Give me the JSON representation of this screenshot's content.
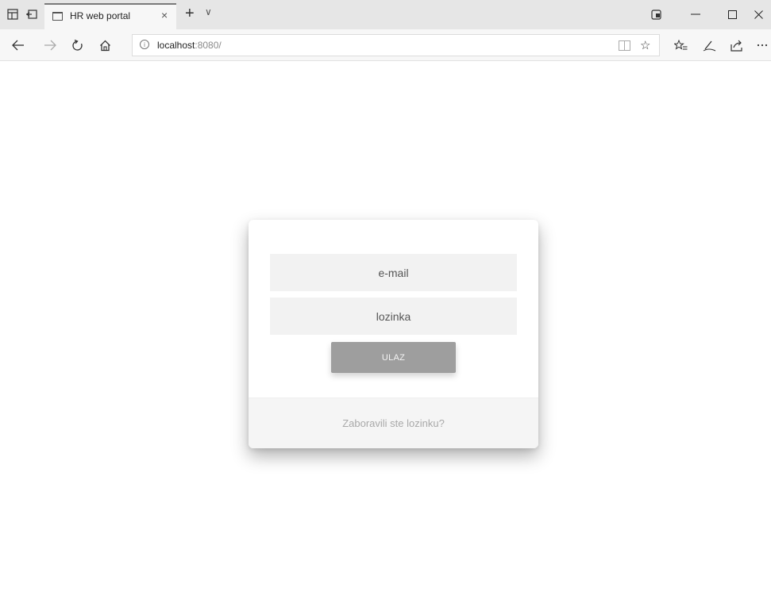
{
  "browser": {
    "tab": {
      "title": "HR web portal",
      "close_glyph": "×"
    },
    "new_tab_glyph": "+",
    "tab_list_glyph": "∨",
    "window_controls": {
      "minimize": "—",
      "maximize": "☐",
      "close": "✕"
    },
    "address": {
      "host": "localhost",
      "rest": ":8080/"
    },
    "icons": {
      "set_aside": "set-aside-tabs-icon",
      "restore_tabs": "restore-tabs-icon",
      "back": "back-arrow-icon",
      "forward": "forward-arrow-icon",
      "refresh": "refresh-icon",
      "home": "home-icon",
      "info": "info-icon",
      "reading_view": "reading-view-icon",
      "favorite": "star-icon",
      "favorites_hub": "favorites-list-icon",
      "pen": "web-note-pen-icon",
      "share": "share-icon",
      "more": "more-ellipsis-icon",
      "extension": "extension-icon"
    }
  },
  "login": {
    "email_placeholder": "e-mail",
    "password_placeholder": "lozinka",
    "submit_label": "ULAZ",
    "forgot_label": "Zaboravili ste lozinku?"
  },
  "colors": {
    "button": "#9e9e9e",
    "field_background": "#f2f2f2",
    "footer_background": "#f5f5f5",
    "link_text": "#a9a9a9"
  }
}
